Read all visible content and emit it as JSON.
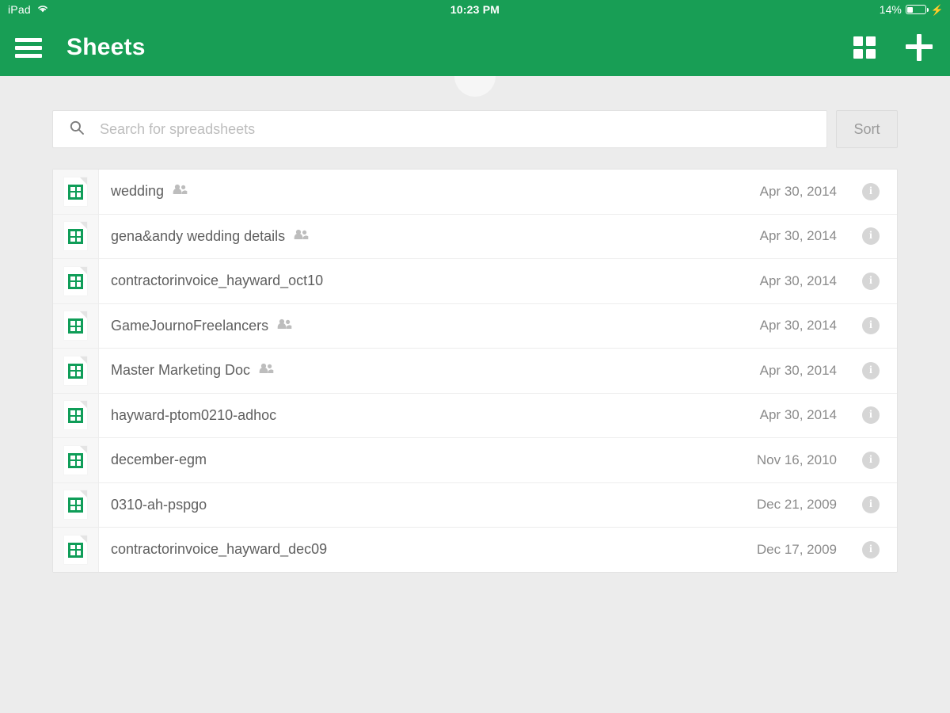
{
  "statusbar": {
    "device": "iPad",
    "wifi_icon": "wifi-icon",
    "time": "10:23 PM",
    "battery_percent": "14%",
    "battery_icon": "battery-icon",
    "charging_icon": "lightning-bolt-icon"
  },
  "appbar": {
    "menu_icon": "hamburger-menu-icon",
    "title": "Sheets",
    "grid_view_icon": "grid-view-icon",
    "new_icon": "plus-icon",
    "accent_color": "#189e55"
  },
  "search": {
    "icon": "search-icon",
    "value": "",
    "placeholder": "Search for spreadsheets",
    "sort_label": "Sort"
  },
  "files": [
    {
      "icon": "spreadsheet-file-icon",
      "name": "wedding",
      "shared": true,
      "date": "Apr 30, 2014",
      "info_label": "i"
    },
    {
      "icon": "spreadsheet-file-icon",
      "name": "gena&andy wedding details",
      "shared": true,
      "date": "Apr 30, 2014",
      "info_label": "i"
    },
    {
      "icon": "spreadsheet-file-icon",
      "name": "contractorinvoice_hayward_oct10",
      "shared": false,
      "date": "Apr 30, 2014",
      "info_label": "i"
    },
    {
      "icon": "spreadsheet-file-icon",
      "name": "GameJournoFreelancers",
      "shared": true,
      "date": "Apr 30, 2014",
      "info_label": "i"
    },
    {
      "icon": "spreadsheet-file-icon",
      "name": "Master Marketing Doc",
      "shared": true,
      "date": "Apr 30, 2014",
      "info_label": "i"
    },
    {
      "icon": "spreadsheet-file-icon",
      "name": "hayward-ptom0210-adhoc",
      "shared": false,
      "date": "Apr 30, 2014",
      "info_label": "i"
    },
    {
      "icon": "spreadsheet-file-icon",
      "name": "december-egm",
      "shared": false,
      "date": "Nov 16, 2010",
      "info_label": "i"
    },
    {
      "icon": "spreadsheet-file-icon",
      "name": "0310-ah-pspgo",
      "shared": false,
      "date": "Dec 21, 2009",
      "info_label": "i"
    },
    {
      "icon": "spreadsheet-file-icon",
      "name": "contractorinvoice_hayward_dec09",
      "shared": false,
      "date": "Dec 17, 2009",
      "info_label": "i"
    }
  ]
}
